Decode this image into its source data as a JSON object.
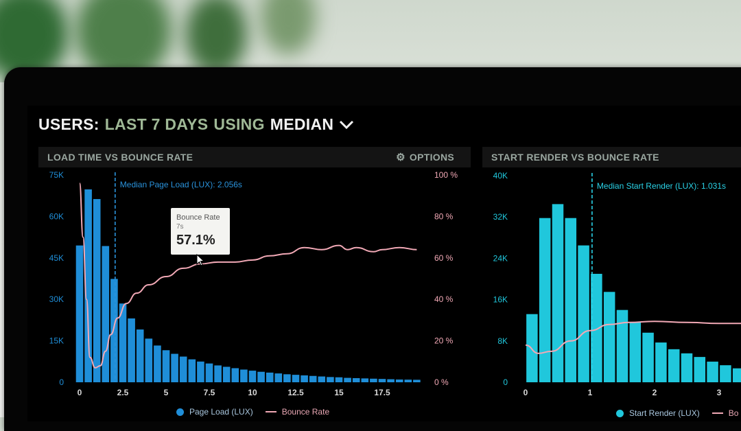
{
  "header": {
    "title_parts": [
      "USERS:",
      "LAST 7 DAYS",
      "USING",
      "MEDIAN"
    ]
  },
  "colors": {
    "page_load": "#1f8ed8",
    "start_render": "#20c7dc",
    "bounce": "#f2a9b6",
    "title_green": "#9fb896",
    "panel_header": "#141414"
  },
  "icons": {
    "chevron": "chevron-down-icon",
    "options": "gear-icon",
    "cursor": "cursor-icon"
  },
  "panels": [
    {
      "title": "LOAD TIME VS BOUNCE RATE",
      "options_label": "OPTIONS",
      "median_label": "Median Page Load (LUX): 2.056s",
      "legend": [
        "Page Load (LUX)",
        "Bounce Rate"
      ],
      "tooltip": {
        "label": "Bounce Rate",
        "sub": "7s",
        "value": "57.1%"
      }
    },
    {
      "title": "START RENDER VS BOUNCE RATE",
      "median_label": "Median Start Render (LUX): 1.031s",
      "legend": [
        "Start Render (LUX)",
        "Bo"
      ]
    }
  ],
  "chart_data": [
    {
      "type": "bar",
      "title": "LOAD TIME VS BOUNCE RATE",
      "x_ticks": [
        "0",
        "2.5",
        "5",
        "7.5",
        "10",
        "12.5",
        "15",
        "17.5"
      ],
      "y_ticks_left": [
        "75K",
        "60K",
        "45K",
        "30K",
        "15K",
        "0"
      ],
      "y_ticks_right": [
        "100 %",
        "80 %",
        "60 %",
        "40 %",
        "20 %",
        "0 %"
      ],
      "ylim_left": [
        0,
        75000
      ],
      "ylim_right": [
        0,
        100
      ],
      "xlim": [
        -0.25,
        19.75
      ],
      "median_x": 2.056,
      "x": [
        0,
        0.5,
        1,
        1.5,
        2,
        2.5,
        3,
        3.5,
        4,
        4.5,
        5,
        5.5,
        6,
        6.5,
        7,
        7.5,
        8,
        8.5,
        9,
        9.5,
        10,
        10.5,
        11,
        11.5,
        12,
        12.5,
        13,
        13.5,
        14,
        14.5,
        15,
        15.5,
        16,
        16.5,
        17,
        17.5,
        18,
        18.5,
        19,
        19.5
      ],
      "series": [
        {
          "name": "Page Load (LUX)",
          "kind": "bar",
          "values": [
            49500,
            69800,
            66300,
            49300,
            37400,
            28500,
            23100,
            19100,
            15800,
            13300,
            11600,
            10300,
            9300,
            8300,
            7500,
            6800,
            6100,
            5600,
            5100,
            4600,
            4200,
            3800,
            3500,
            3200,
            2900,
            2700,
            2500,
            2300,
            2100,
            1900,
            1800,
            1600,
            1500,
            1400,
            1300,
            1200,
            1100,
            1000,
            950,
            900
          ]
        },
        {
          "name": "Bounce Rate",
          "kind": "line",
          "points": [
            [
              0,
              96
            ],
            [
              0.2,
              70
            ],
            [
              0.4,
              40
            ],
            [
              0.6,
              12
            ],
            [
              0.9,
              7
            ],
            [
              1.2,
              8
            ],
            [
              1.5,
              15
            ],
            [
              1.8,
              23
            ],
            [
              2.2,
              31
            ],
            [
              2.7,
              38
            ],
            [
              3.3,
              43
            ],
            [
              4,
              47
            ],
            [
              5,
              51
            ],
            [
              6,
              55
            ],
            [
              7,
              57.1
            ],
            [
              8,
              58
            ],
            [
              9,
              58
            ],
            [
              10,
              59
            ],
            [
              11,
              61
            ],
            [
              12,
              62
            ],
            [
              13,
              65
            ],
            [
              14,
              64
            ],
            [
              15,
              66
            ],
            [
              15.5,
              64
            ],
            [
              16,
              65
            ],
            [
              17,
              63
            ],
            [
              17.5,
              64
            ],
            [
              18.5,
              65
            ],
            [
              19.5,
              64
            ]
          ]
        }
      ]
    },
    {
      "type": "bar",
      "title": "START RENDER VS BOUNCE RATE",
      "x_ticks": [
        "0",
        "1",
        "2",
        "3"
      ],
      "y_ticks_left": [
        "40K",
        "32K",
        "24K",
        "16K",
        "8K",
        "0"
      ],
      "ylim_left": [
        0,
        40000
      ],
      "ylim_right": [
        0,
        100
      ],
      "median_x": 1.031,
      "x": [
        0.1,
        0.3,
        0.5,
        0.7,
        0.9,
        1.1,
        1.3,
        1.5,
        1.7,
        1.9,
        2.1,
        2.3,
        2.5,
        2.7,
        2.9,
        3.1,
        3.3
      ],
      "series": [
        {
          "name": "Start Render (LUX)",
          "kind": "bar",
          "values": [
            13200,
            31800,
            34500,
            31800,
            26500,
            21000,
            17500,
            14000,
            11600,
            9600,
            7700,
            6400,
            5600,
            4900,
            4000,
            3300,
            2700
          ]
        },
        {
          "name": "Bo",
          "kind": "line",
          "points": [
            [
              0,
              18
            ],
            [
              0.2,
              14
            ],
            [
              0.4,
              15
            ],
            [
              0.7,
              20
            ],
            [
              1,
              25
            ],
            [
              1.3,
              28
            ],
            [
              1.6,
              29
            ],
            [
              2,
              29.5
            ],
            [
              2.5,
              29
            ],
            [
              3,
              28.5
            ],
            [
              3.4,
              28.5
            ]
          ]
        }
      ]
    }
  ]
}
